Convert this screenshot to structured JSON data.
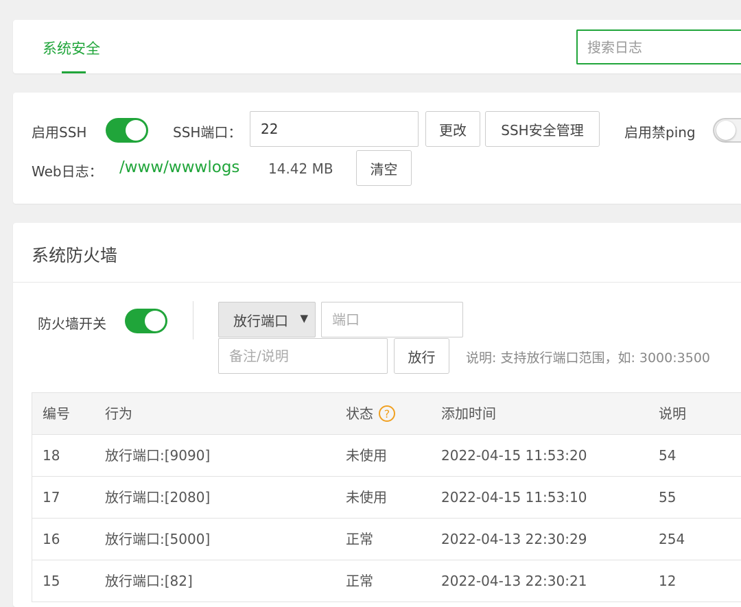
{
  "header": {
    "tab_label": "系统安全",
    "search_placeholder": "搜索日志"
  },
  "ssh": {
    "enable_ssh_label": "启用SSH",
    "enable_ssh_on": true,
    "port_label": "SSH端口：",
    "port_value": "22",
    "change_button": "更改",
    "manage_button": "SSH安全管理",
    "ping_label": "启用禁ping",
    "ping_on": false,
    "weblog_label": "Web日志：",
    "weblog_path": "/www/wwwlogs",
    "weblog_size": "14.42 MB",
    "clear_button": "清空"
  },
  "firewall": {
    "title": "系统防火墙",
    "switch_label": "防火墙开关",
    "switch_on": true,
    "action_selected": "放行端口",
    "port_placeholder": "端口",
    "remark_placeholder": "备注/说明",
    "allow_button": "放行",
    "note": "说明: 支持放行端口范围，如: 3000:3500",
    "table": {
      "headers": [
        "编号",
        "行为",
        "状态",
        "添加时间",
        "说明"
      ],
      "rows": [
        {
          "id": "18",
          "action": "放行端口:[9090]",
          "status": "未使用",
          "time": "2022-04-15 11:53:20",
          "remark": "54"
        },
        {
          "id": "17",
          "action": "放行端口:[2080]",
          "status": "未使用",
          "time": "2022-04-15 11:53:10",
          "remark": "55"
        },
        {
          "id": "16",
          "action": "放行端口:[5000]",
          "status": "正常",
          "time": "2022-04-13 22:30:29",
          "remark": "254"
        },
        {
          "id": "15",
          "action": "放行端口:[82]",
          "status": "正常",
          "time": "2022-04-13 22:30:21",
          "remark": "12"
        }
      ]
    }
  },
  "colors": {
    "accent": "#20a53a",
    "help_icon": "#f0a020"
  }
}
